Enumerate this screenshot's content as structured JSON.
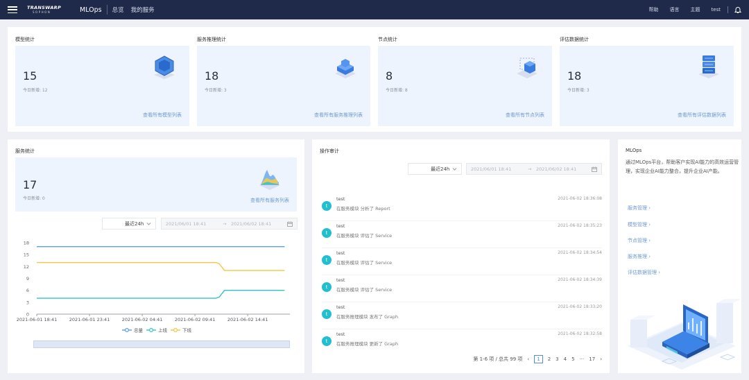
{
  "header": {
    "logo_line1": "TRANSWARP",
    "logo_line2": "SOPHON",
    "app_title": "MLOps",
    "nav": [
      "总览",
      "我的服务"
    ],
    "right": [
      "帮助",
      "语言",
      "主题",
      "test"
    ]
  },
  "stats": [
    {
      "title": "模型统计",
      "value": "15",
      "sub": "今日新增: 12",
      "link": "查看所有模型列表",
      "icon": "cube-icon"
    },
    {
      "title": "服务推理统计",
      "value": "18",
      "sub": "今日新增: 3",
      "link": "查看所有服务推理列表",
      "icon": "server-block-icon"
    },
    {
      "title": "节点统计",
      "value": "8",
      "sub": "今日新增: 8",
      "link": "查看所有节点列表",
      "icon": "node-icon"
    },
    {
      "title": "评估数据统计",
      "value": "18",
      "sub": "今日新增: 3",
      "link": "查看所有评估数据列表",
      "icon": "database-icon"
    }
  ],
  "service": {
    "title": "服务统计",
    "value": "17",
    "sub": "今日新增: 0",
    "link": "查看所有服务列表",
    "select": "最近24h",
    "date_from": "2021/06/01 18:41",
    "date_to": "2021/06/02 18:41"
  },
  "chart_data": {
    "type": "line",
    "x": [
      "2021-06-01 18:41",
      "2021-06-01 23:41",
      "2021-06-02 04:41",
      "2021-06-02 09:41",
      "2021-06-02 14:41"
    ],
    "ylim": [
      0,
      18
    ],
    "yticks": [
      0,
      3,
      6,
      9,
      12,
      15,
      18
    ],
    "xrange": [
      0,
      24
    ],
    "series": [
      {
        "name": "总量",
        "color": "#5b9bf0",
        "points": [
          [
            0,
            17
          ],
          [
            23.5,
            17
          ]
        ]
      },
      {
        "name": "上线",
        "color": "#2ec4c4",
        "points": [
          [
            0,
            4
          ],
          [
            17,
            4
          ],
          [
            17.3,
            4.3
          ],
          [
            17.8,
            6
          ],
          [
            23.5,
            6
          ]
        ]
      },
      {
        "name": "下线",
        "color": "#f5c542",
        "points": [
          [
            0,
            13
          ],
          [
            17,
            13
          ],
          [
            17.3,
            12.7
          ],
          [
            17.8,
            11
          ],
          [
            23.5,
            11
          ]
        ]
      }
    ]
  },
  "audit": {
    "title": "操作审计",
    "select": "最近24h",
    "date_from": "2021/06/01 18:41",
    "date_to": "2021/06/02 18:41",
    "items": [
      {
        "avatar": "t",
        "user": "test",
        "action": "在服务模块 分析了 Report",
        "time": "2021-06-02 18:36:08"
      },
      {
        "avatar": "t",
        "user": "test",
        "action": "在服务模块 评估了 Service",
        "time": "2021-06-02 18:35:23"
      },
      {
        "avatar": "t",
        "user": "test",
        "action": "在服务模块 评估了 Service",
        "time": "2021-06-02 18:34:54"
      },
      {
        "avatar": "t",
        "user": "test",
        "action": "在服务模块 评估了 Service",
        "time": "2021-06-02 18:34:39"
      },
      {
        "avatar": "t",
        "user": "test",
        "action": "在服务推理模块 发布了 Graph",
        "time": "2021-06-02 18:33:20"
      },
      {
        "avatar": "t",
        "user": "test",
        "action": "在服务推理模块 更新了 Graph",
        "time": "2021-06-02 18:32:58"
      }
    ],
    "pager": {
      "summary": "第 1-6 项 / 总共 99 项",
      "pages": [
        "1",
        "2",
        "3",
        "4",
        "5",
        "···",
        "17"
      ]
    }
  },
  "mlops": {
    "title": "MLOps",
    "desc": "通过MLOps平台，帮助客户实现AI能力的高效运营管理，实现企业AI能力整合，提升企业AI产能。",
    "links": [
      "服务管理 ›",
      "模型管理 ›",
      "节点管理 ›",
      "服务推理 ›",
      "评估数据管理 ›"
    ]
  }
}
